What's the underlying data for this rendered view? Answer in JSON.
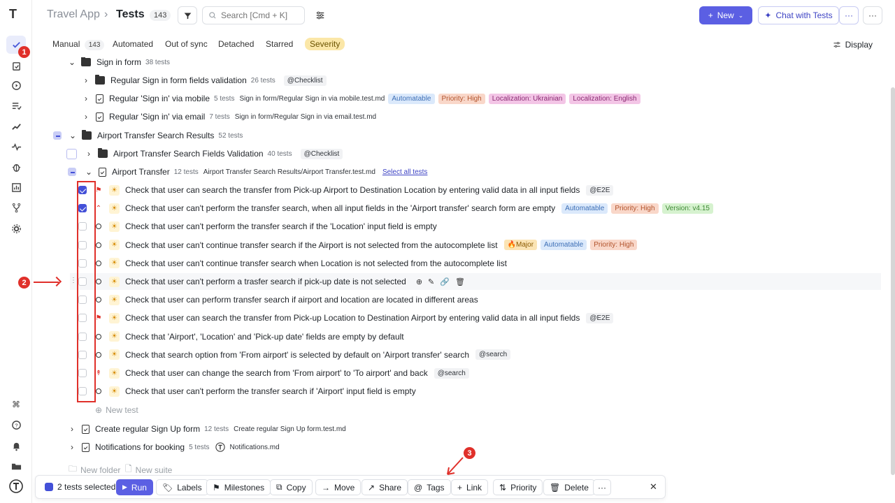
{
  "colors": {
    "accent": "#5b5fe3",
    "annotation": "#e0302a"
  },
  "sidebar": {
    "logo": "T",
    "badge": "1",
    "items": [
      "check-icon",
      "clipboard-icon",
      "play-icon",
      "list-check-icon",
      "chart-line-icon",
      "pulse-icon",
      "bug-icon",
      "bar-chart-icon",
      "branch-icon",
      "gear-icon"
    ],
    "bottom": [
      "command-icon",
      "help-icon",
      "bell-icon",
      "folder-icon",
      "testomat-logo"
    ]
  },
  "header": {
    "project": "Travel App",
    "sep": "›",
    "title": "Tests",
    "count": "143",
    "search_placeholder": "Search [Cmd + K]",
    "new_label": "New",
    "chat_label": "Chat with Tests",
    "more": "···"
  },
  "tabs": {
    "manual": "Manual",
    "manual_count": "143",
    "automated": "Automated",
    "out_of_sync": "Out of sync",
    "detached": "Detached",
    "starred": "Starred",
    "severity": "Severity",
    "display": "Display"
  },
  "tree": {
    "signin": {
      "name": "Sign in form",
      "meta": "38 tests"
    },
    "signin_fields": {
      "name": "Regular Sign in form fields validation",
      "meta": "26 tests",
      "tag": "@Checklist"
    },
    "signin_mobile": {
      "name": "Regular 'Sign in' via mobile",
      "meta": "5 tests",
      "path": "Sign in form/Regular Sign in via mobile.test.md",
      "tags": [
        "Automatable",
        "Priority: High",
        "Localization: Ukrainian",
        "Localization: English"
      ]
    },
    "signin_email": {
      "name": "Regular 'Sign in' via email",
      "meta": "7 tests",
      "path": "Sign in form/Regular Sign in via email.test.md"
    },
    "airport": {
      "name": "Airport Transfer Search Results",
      "meta": "52 tests"
    },
    "airport_fields": {
      "name": "Airport Transfer Search Fields Validation",
      "meta": "40 tests",
      "tag": "@Checklist"
    },
    "airport_transfer": {
      "name": "Airport Transfer",
      "meta": "12 tests",
      "path": "Airport Transfer Search Results/Airport Transfer.test.md",
      "link": "Select all tests"
    },
    "tests": [
      {
        "title": "Check that user can search the transfer from Pick-up Airport to Destination Location by entering valid data in all input fields",
        "tags": [
          "@E2E"
        ]
      },
      {
        "title": "Check that user can't perform the transfer search, when all input fields in the 'Airport transfer' search form are empty",
        "tags": [
          "Automatable",
          "Priority: High",
          "Version: v4.15"
        ]
      },
      {
        "title": "Check that user can't perform the transfer search if the 'Location' input field is empty",
        "tags": []
      },
      {
        "title": "Check that user can't continue transfer search if the Airport is not selected from the autocomplete list",
        "tags": [
          "🔥Major",
          "Automatable",
          "Priority: High"
        ]
      },
      {
        "title": "Check that user can't continue transfer search when Location is not selected from the autocomplete list",
        "tags": []
      },
      {
        "title": "Check that user can't perform a trasfer search if pick-up date is not selected",
        "tags": []
      },
      {
        "title": "Check that user can perform transfer search if airport and location are located in different areas",
        "tags": []
      },
      {
        "title": "Check that user can search the transfer from Pick-up Location to Destination Airport by entering valid data in all input fields",
        "tags": [
          "@E2E"
        ]
      },
      {
        "title": "Check that 'Airport', 'Location' and 'Pick-up date' fields are empty by default",
        "tags": []
      },
      {
        "title": "Check that search option from 'From airport' is selected by default on 'Airport transfer' search",
        "tags": [
          "@search"
        ]
      },
      {
        "title": "Check that user can change the search from 'From airport' to 'To airport' and back",
        "tags": [
          "@search"
        ]
      },
      {
        "title": "Check that user can't perform the transfer search if 'Airport' input field is empty",
        "tags": []
      }
    ],
    "new_test": "New test",
    "signup": {
      "name": "Create regular Sign Up form",
      "meta": "12 tests",
      "path": "Create regular Sign Up form.test.md"
    },
    "notif": {
      "name": "Notifications for booking",
      "meta": "5 tests",
      "path": "Notifications.md"
    },
    "new_folder": "New folder",
    "new_suite": "New suite"
  },
  "annotations": {
    "a1": "1",
    "a2": "2",
    "a3": "3"
  },
  "bottom": {
    "selected": "2 tests selected",
    "run": "Run",
    "labels": "Labels",
    "milestones": "Milestones",
    "copy": "Copy",
    "move": "Move",
    "share": "Share",
    "tags": "Tags",
    "link": "Link",
    "priority": "Priority",
    "delete": "Delete",
    "more": "···",
    "close": "✕"
  }
}
